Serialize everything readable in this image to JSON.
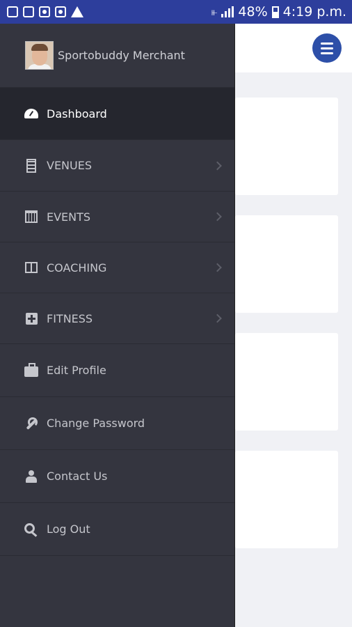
{
  "status_bar": {
    "notification_icons": [
      "gallery-icon",
      "sim-icon",
      "settings-icon",
      "settings-icon",
      "warning-icon"
    ],
    "battery_percent": "48%",
    "time": "4:19 p.m."
  },
  "drawer": {
    "profile_name": "Sportobuddy Merchant",
    "items": [
      {
        "label": "Dashboard",
        "icon": "dashboard-gauge-icon",
        "active": true,
        "has_submenu": false
      },
      {
        "label": "VENUES",
        "icon": "building-icon",
        "active": false,
        "has_submenu": true
      },
      {
        "label": "EVENTS",
        "icon": "calendar-icon",
        "active": false,
        "has_submenu": true
      },
      {
        "label": "COACHING",
        "icon": "book-icon",
        "active": false,
        "has_submenu": true
      },
      {
        "label": "FITNESS",
        "icon": "plus-square-icon",
        "active": false,
        "has_submenu": true
      },
      {
        "label": "Edit Profile",
        "icon": "briefcase-icon",
        "active": false,
        "has_submenu": false
      },
      {
        "label": "Change Password",
        "icon": "wrench-icon",
        "active": false,
        "has_submenu": false
      },
      {
        "label": "Contact Us",
        "icon": "user-icon",
        "active": false,
        "has_submenu": false
      },
      {
        "label": "Log Out",
        "icon": "key-icon",
        "active": false,
        "has_submenu": false
      }
    ]
  },
  "colors": {
    "status_bar": "#2d3e9c",
    "drawer_bg": "#34353f",
    "drawer_active": "#25262e",
    "menu_button": "#2d4fa8",
    "page_bg": "#f0f1f5"
  }
}
